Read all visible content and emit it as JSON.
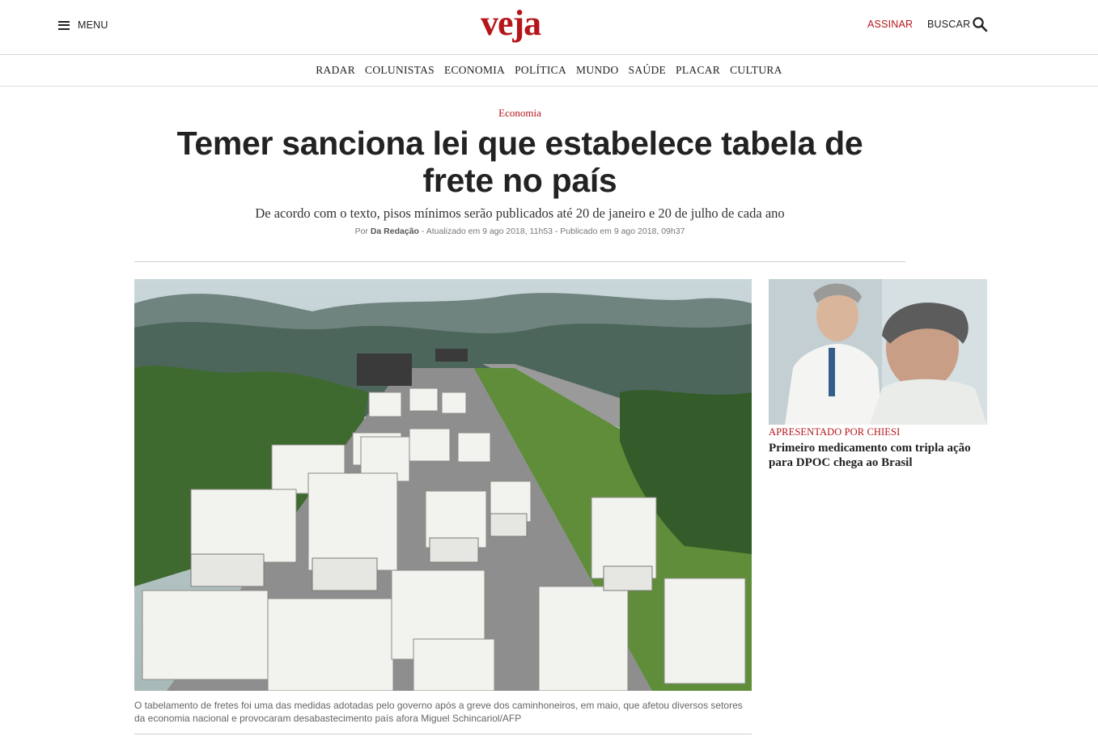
{
  "header": {
    "menu_label": "MENU",
    "logo": "veja",
    "subscribe_label": "ASSINAR",
    "search_label": "BUSCAR",
    "brand_color": "#b5161a"
  },
  "nav": {
    "items": [
      "RADAR",
      "COLUNISTAS",
      "ECONOMIA",
      "POLÍTICA",
      "MUNDO",
      "SAÚDE",
      "PLACAR",
      "CULTURA"
    ]
  },
  "article": {
    "section": "Economia",
    "headline": "Temer sanciona lei que estabelece tabela de frete no país",
    "dek": "De acordo com o texto, pisos mínimos serão publicados até 20 de janeiro e 20 de julho de cada ano",
    "byline": {
      "prefix": "Por",
      "author": "Da Redação",
      "updated": " - Atualizado em 9 ago 2018, 11h53 - Publicado em 9 ago 2018, 09h37"
    },
    "image_caption": "O tabelamento de fretes foi uma das medidas adotadas pelo governo após a greve dos caminhoneiros, em maio, que afetou diversos setores da economia nacional e provocaram desabastecimento país afora Miguel Schincariol/AFP"
  },
  "sidebar": {
    "promo": {
      "label": "APRESENTADO POR CHIESI",
      "title": "Primeiro medicamento com tripla ação para DPOC chega ao Brasil"
    }
  }
}
